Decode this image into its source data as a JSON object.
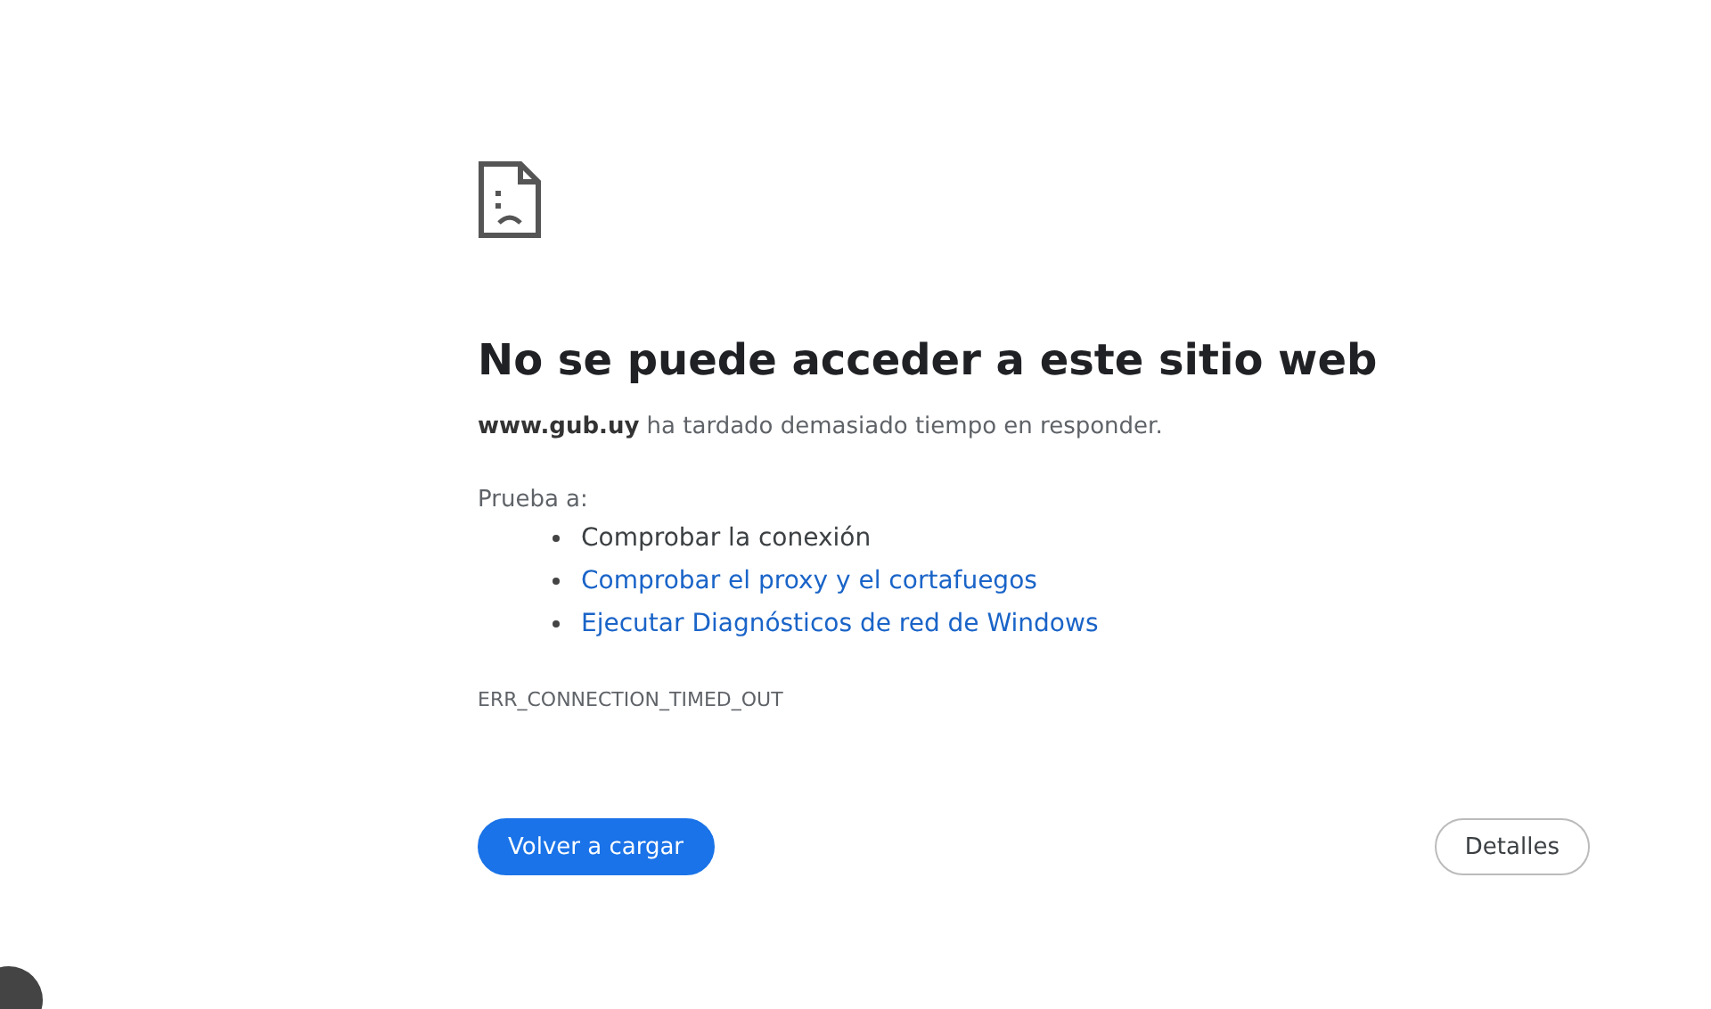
{
  "heading": "No se puede acceder a este sitio web",
  "message": "**www.gub.uy** ha tardado demasiado tiempo en responder.",
  "suggestions_intro": "Prueba a:",
  "suggestions": [
    {
      "kind": "text",
      "label": "Comprobar la conexión"
    },
    {
      "kind": "link",
      "label": "Comprobar el proxy y el cortafuegos"
    },
    {
      "kind": "link",
      "label": "Ejecutar Diagnósticos de red de Windows"
    }
  ],
  "error_code": "ERR_CONNECTION_TIMED_OUT",
  "buttons": [
    {
      "kind": "primary",
      "label": "Volver a cargar"
    },
    {
      "kind": "secondary",
      "label": "Detalles"
    }
  ]
}
